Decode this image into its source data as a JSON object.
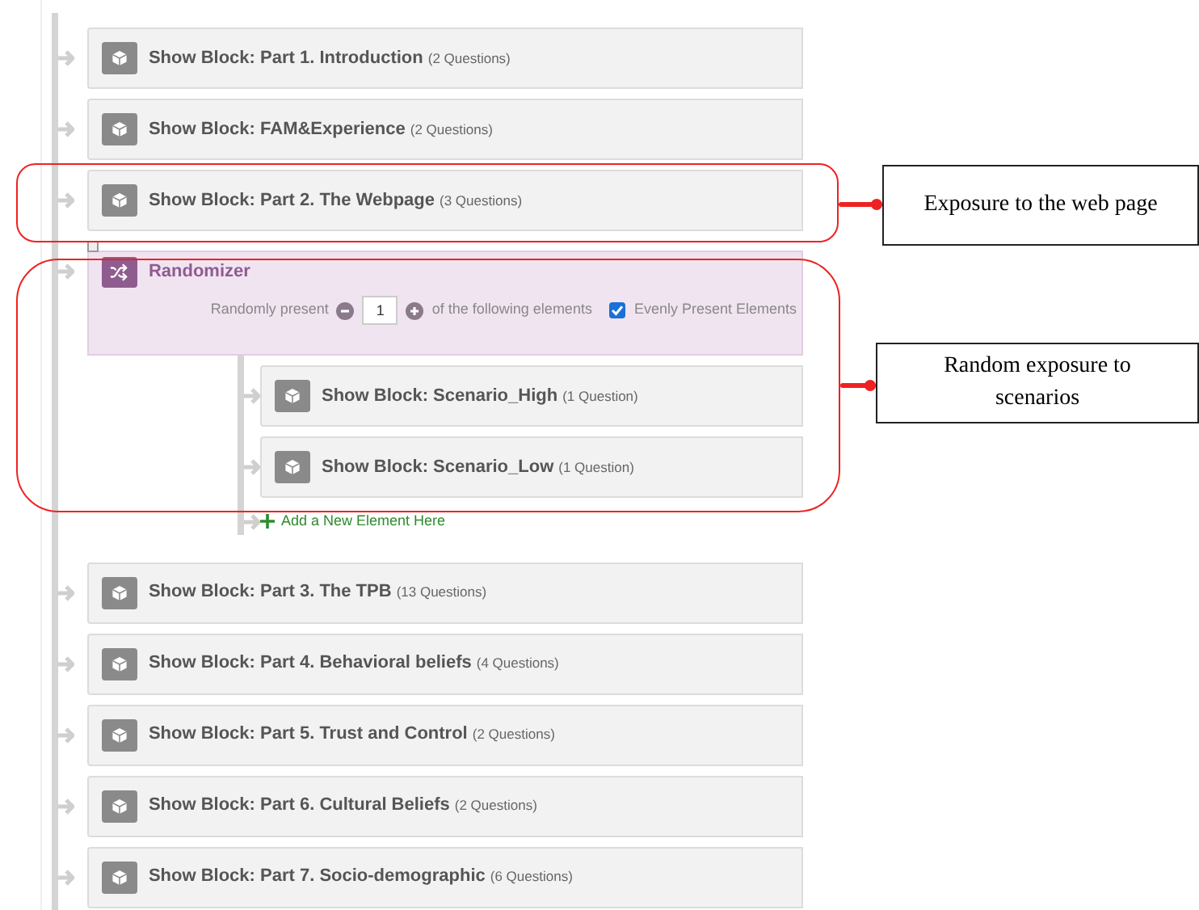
{
  "flow": [
    {
      "kind": "block",
      "title": "Show Block: Part 1. Introduction",
      "count": "(2 Questions)"
    },
    {
      "kind": "block",
      "title": "Show Block: FAM&Experience",
      "count": "(2 Questions)"
    },
    {
      "kind": "block",
      "title": "Show Block: Part 2. The Webpage",
      "count": "(3 Questions)"
    },
    {
      "kind": "randomizer",
      "title": "Randomizer",
      "prefix": "Randomly present",
      "value": "1",
      "suffix": "of the following elements",
      "evenly": {
        "label": "Evenly Present Elements",
        "checked": true
      },
      "children": [
        {
          "title": "Show Block: Scenario_High",
          "count": "(1 Question)"
        },
        {
          "title": "Show Block: Scenario_Low",
          "count": "(1 Question)"
        }
      ],
      "add_label": "Add a New Element Here"
    },
    {
      "kind": "block",
      "title": "Show Block: Part 3. The TPB",
      "count": "(13 Questions)"
    },
    {
      "kind": "block",
      "title": "Show Block: Part 4. Behavioral beliefs",
      "count": "(4 Questions)"
    },
    {
      "kind": "block",
      "title": "Show Block: Part 5. Trust and Control",
      "count": "(2 Questions)"
    },
    {
      "kind": "block",
      "title": "Show Block: Part 6. Cultural Beliefs",
      "count": "(2 Questions)"
    },
    {
      "kind": "block",
      "title": "Show Block: Part 7. Socio-demographic",
      "count": "(6 Questions)"
    }
  ],
  "annotations": [
    {
      "label": "Exposure to the web page"
    },
    {
      "label": "Random exposure to scenarios"
    }
  ]
}
